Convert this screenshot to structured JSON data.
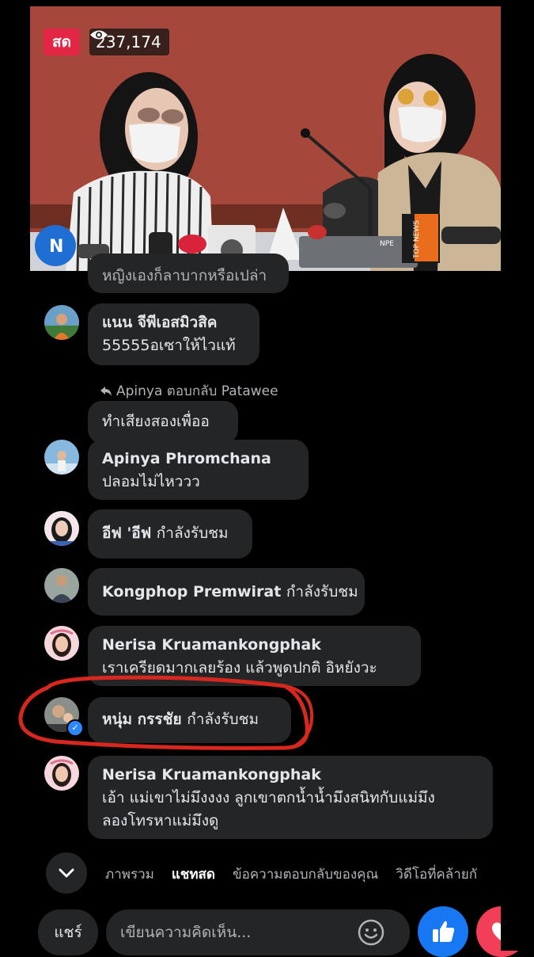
{
  "video": {
    "live_label": "สด",
    "viewer_count": "237,174",
    "mic_labels": {
      "top_news": "TOP NEWS",
      "npe": "NPE"
    }
  },
  "comments": [
    {
      "partial_text": "หญิงเองก็ลาบากหรือเปล่า"
    },
    {
      "name": "แนน จีพีเอสมิวสิค",
      "text": "55555อเซาให้ไวแท้"
    },
    {
      "reply_note": "Apinya ตอบกลับ Patawee",
      "text": "ทำเสียงสองเพื่ออ"
    },
    {
      "name": "Apinya Phromchana",
      "text": "ปลอมไม่ไหววว"
    },
    {
      "name": "อีฟ 'อีฟ",
      "suffix": "กำลังรับชม"
    },
    {
      "name": "Kongphop Premwirat",
      "suffix": "กำลังรับชม"
    },
    {
      "name": "Nerisa Kruamankongphak",
      "text": "เราเครียดมากเลยร้อง แล้วพูดปกติ อิหยังวะ"
    },
    {
      "name": "หนุ่ม กรรชัย",
      "suffix": "กำลังรับชม"
    },
    {
      "name": "Nerisa Kruamankongphak",
      "text_line1": "เอ้า แม่เขาไม่มึงงงง ลูกเขาตกน้ำน้ำมึงสนิทกับแม่มึง",
      "text_line2": "ลองโทรหาแม่มึงดู"
    }
  ],
  "tabs": [
    "ภาพรวม",
    "แชทสด",
    "ข้อความตอบกลับของคุณ",
    "วิดีโอที่คล้ายกั"
  ],
  "active_tab": "แชทสด",
  "bottom": {
    "share_label": "แชร์",
    "comment_placeholder": "เขียนความคิดเห็น..."
  },
  "colors": {
    "background": "#000000",
    "bubble": "#242526",
    "live_red": "#e42645",
    "like_blue": "#1877f2",
    "annotation_red": "#d6281e"
  }
}
